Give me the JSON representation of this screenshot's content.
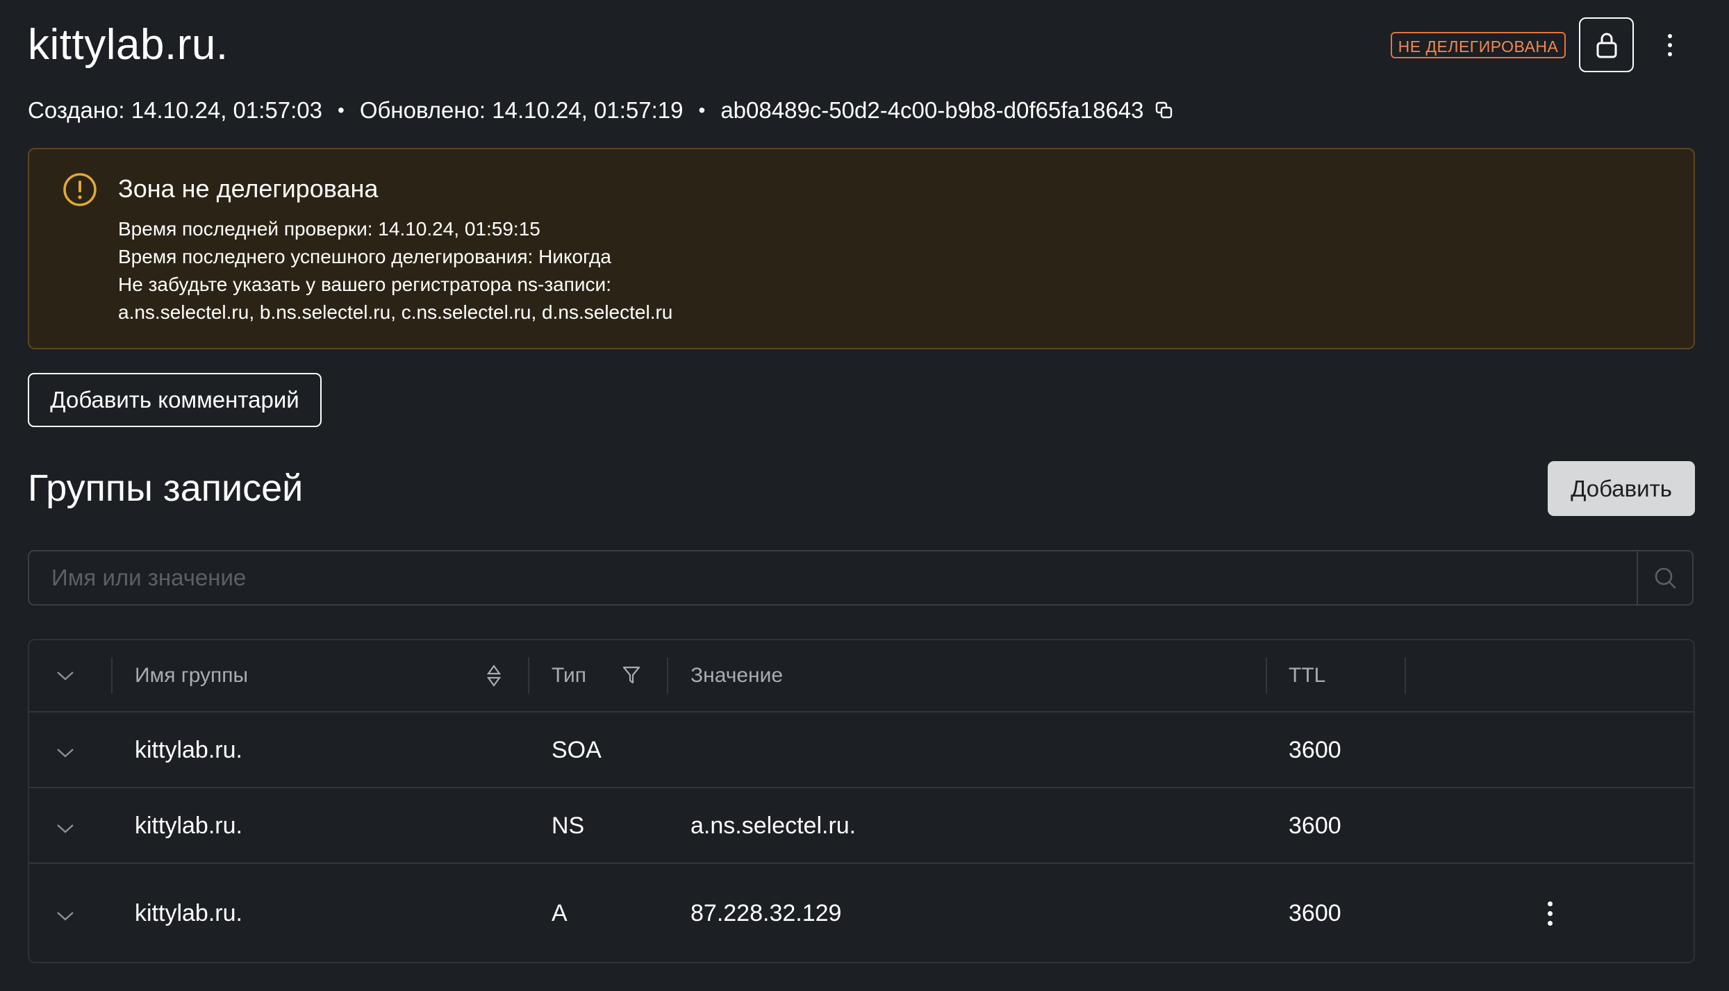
{
  "header": {
    "zone_name": "kittylab.ru.",
    "status_badge": "НЕ ДЕЛЕГИРОВАНА",
    "created": "Создано: 14.10.24, 01:57:03",
    "updated": "Обновлено: 14.10.24, 01:57:19",
    "zone_id": "ab08489c-50d2-4c00-b9b8-d0f65fa18643",
    "separator": "•"
  },
  "warning": {
    "title": "Зона не делегирована",
    "lines": [
      "Время последней проверки: 14.10.24, 01:59:15",
      "Время последнего успешного делегирования: Никогда",
      "Не забудьте указать у вашего регистратора ns-записи:",
      "a.ns.selectel.ru, b.ns.selectel.ru, c.ns.selectel.ru, d.ns.selectel.ru"
    ]
  },
  "comment_button": "Добавить комментарий",
  "records_section": {
    "title": "Группы записей",
    "add_button": "Добавить",
    "search_placeholder": "Имя или значение"
  },
  "table": {
    "columns": {
      "name": "Имя группы",
      "type": "Тип",
      "value": "Значение",
      "ttl": "TTL"
    },
    "rows": [
      {
        "name": "kittylab.ru.",
        "type": "SOA",
        "value": "",
        "ttl": "3600"
      },
      {
        "name": "kittylab.ru.",
        "type": "NS",
        "value": "a.ns.selectel.ru.",
        "ttl": "3600"
      },
      {
        "name": "kittylab.ru.",
        "type": "A",
        "value": "87.228.32.129",
        "ttl": "3600"
      }
    ]
  },
  "colors": {
    "background": "#1c1f23",
    "warning_bg": "#2b2416",
    "warning_accent": "#e0a93a",
    "badge": "#e8733e"
  },
  "icons": {
    "lock": "lock-icon",
    "menu": "more-vertical-icon",
    "copy": "copy-icon",
    "warning": "alert-circle-icon",
    "search": "search-icon",
    "expand": "chevron-down-icon",
    "sort": "sort-icon",
    "filter": "filter-icon"
  }
}
